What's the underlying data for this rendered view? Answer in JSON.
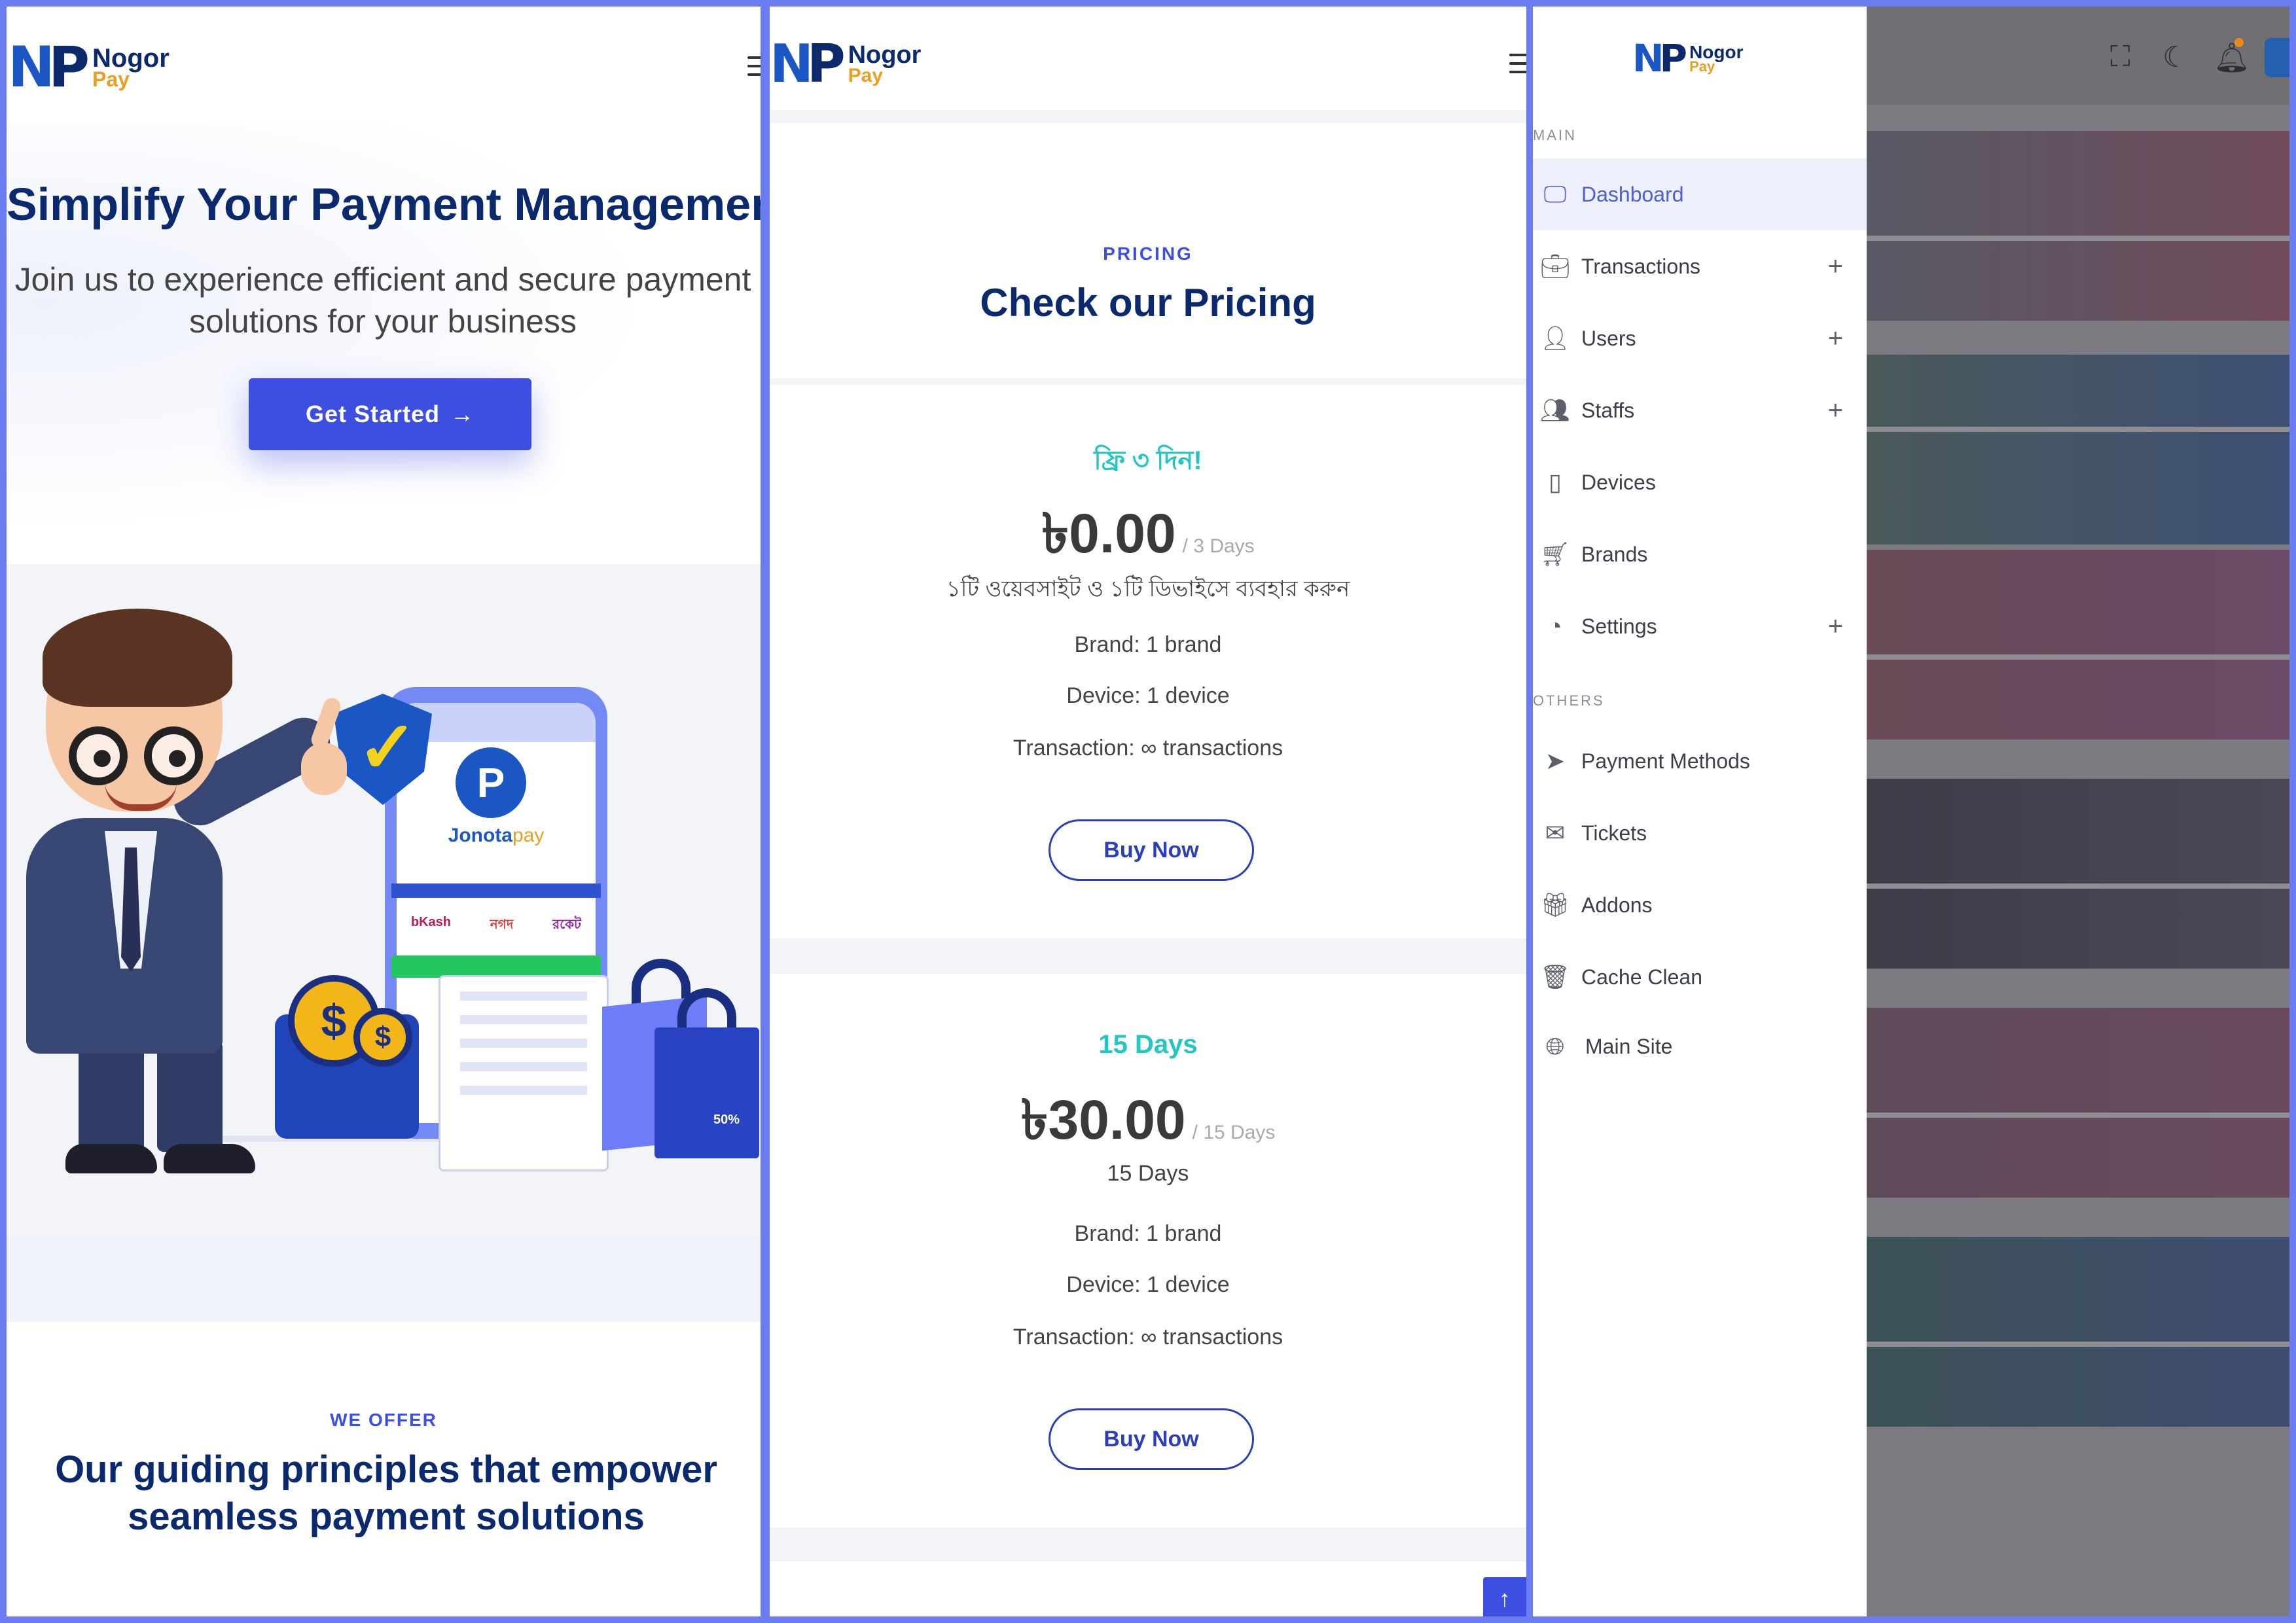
{
  "colors": {
    "primary": "#3d4fe0",
    "navy": "#0b2a6e",
    "teal": "#22c7c3",
    "logo_orange": "#e9a020",
    "frame": "#6a7cf0"
  },
  "brand": {
    "name_line1": "Nogor",
    "name_line2": "Pay",
    "mark_n": "N",
    "mark_p": "P"
  },
  "landing": {
    "hero_title": "Simplify Your Payment Management",
    "hero_subtitle": "Join us to experience efficient and secure payment solutions for your business",
    "cta_label": "Get Started",
    "cta_icon": "arrow-right-icon",
    "illustration": {
      "app_mark": "P",
      "app_name_1": "Jonota",
      "app_name_2": "pay",
      "wallets": [
        "bKash",
        "নগদ",
        "রকেট"
      ],
      "coin_symbol": "$",
      "bag_badge": "50%"
    },
    "offer_kicker": "WE OFFER",
    "offer_title": "Our guiding principles that empower seamless payment solutions"
  },
  "pricing": {
    "kicker": "PRICING",
    "title": "Check our Pricing",
    "plans": [
      {
        "name": "ফ্রি ৩ দিন!",
        "price": "৳0.00",
        "period": "/ 3 Days",
        "description": "১টি ওয়েবসাইট ও ১টি ডিভাইসে ব্যবহার করুন",
        "brand": "Brand: 1 brand",
        "device": "Device: 1 device",
        "transaction": "Transaction: ∞ transactions",
        "button": "Buy Now"
      },
      {
        "name": "15 Days",
        "price": "৳30.00",
        "period": "/ 15 Days",
        "description": "15 Days",
        "brand": "Brand: 1 brand",
        "device": "Device: 1 device",
        "transaction": "Transaction: ∞ transactions",
        "button": "Buy Now"
      }
    ],
    "scroll_top_icon": "arrow-up-icon"
  },
  "admin": {
    "group_main": "MAIN",
    "group_others": "OTHERS",
    "items": [
      {
        "label": "Dashboard",
        "icon": "monitor-icon",
        "active": true
      },
      {
        "label": "Transactions",
        "icon": "briefcase-icon",
        "expandable": true
      },
      {
        "label": "Users",
        "icon": "user-icon",
        "expandable": true
      },
      {
        "label": "Staffs",
        "icon": "users-icon",
        "expandable": true
      },
      {
        "label": "Devices",
        "icon": "smartphone-icon"
      },
      {
        "label": "Brands",
        "icon": "cart-icon"
      },
      {
        "label": "Settings",
        "icon": "pie-chart-icon",
        "expandable": true
      },
      {
        "label": "Payment Methods",
        "icon": "send-icon"
      },
      {
        "label": "Tickets",
        "icon": "mail-icon"
      },
      {
        "label": "Addons",
        "icon": "gift-icon"
      },
      {
        "label": "Cache Clean",
        "icon": "trash-icon"
      },
      {
        "label": "Main Site",
        "icon": "globe-icon"
      }
    ],
    "expand_glyph": "+",
    "topbar_icons": [
      "fullscreen-icon",
      "moon-icon",
      "bell-icon",
      "avatar"
    ]
  }
}
